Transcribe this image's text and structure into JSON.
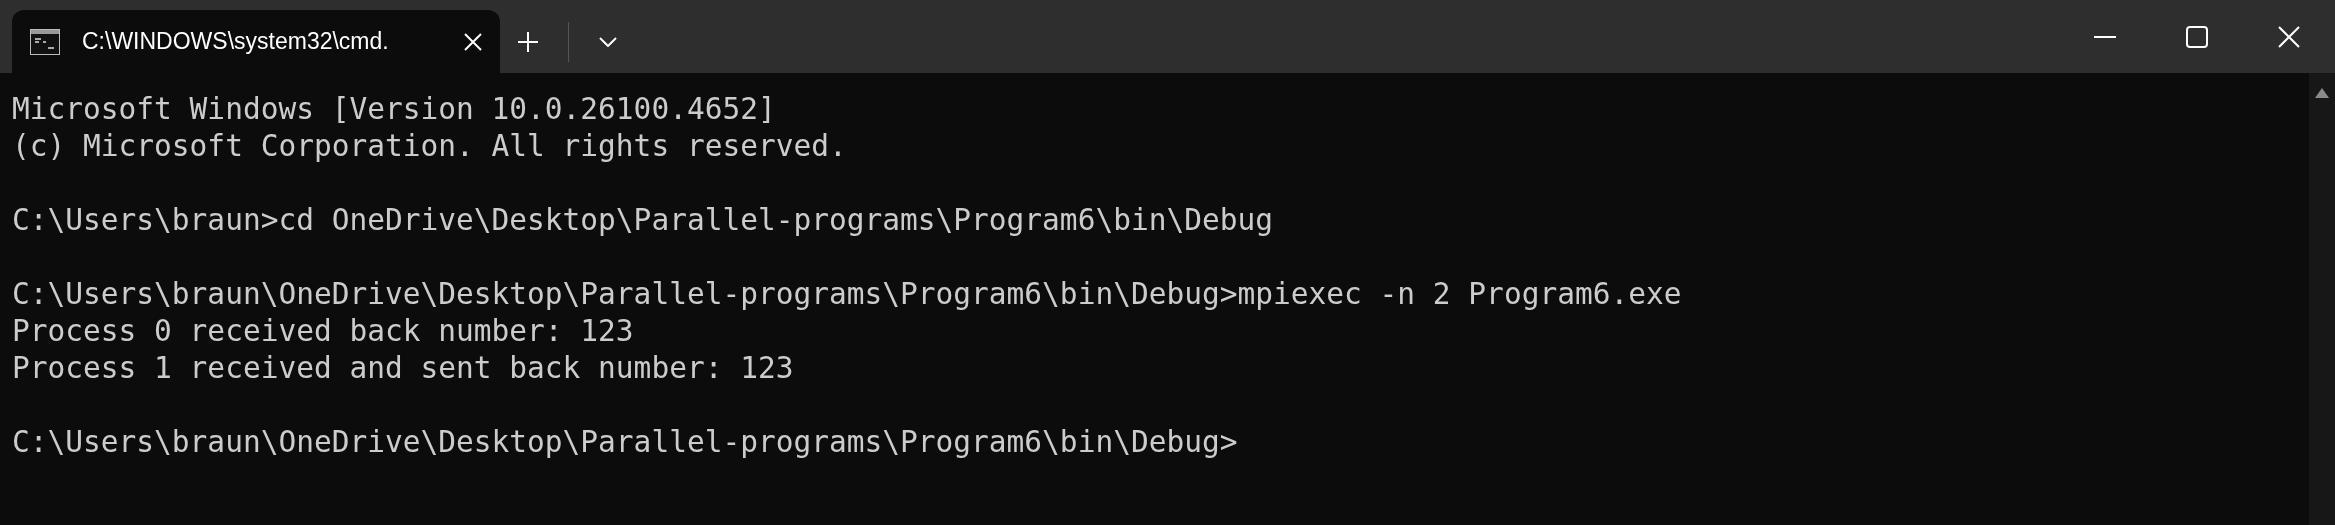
{
  "tabs": [
    {
      "title": "C:\\WINDOWS\\system32\\cmd.",
      "selected": true
    }
  ],
  "terminal": {
    "blocks": [
      [
        "Microsoft Windows [Version 10.0.26100.4652]",
        "(c) Microsoft Corporation. All rights reserved."
      ],
      [
        "C:\\Users\\braun>cd OneDrive\\Desktop\\Parallel-programs\\Program6\\bin\\Debug"
      ],
      [
        "C:\\Users\\braun\\OneDrive\\Desktop\\Parallel-programs\\Program6\\bin\\Debug>mpiexec -n 2 Program6.exe",
        "Process 0 received back number: 123",
        "Process 1 received and sent back number: 123"
      ],
      [
        "C:\\Users\\braun\\OneDrive\\Desktop\\Parallel-programs\\Program6\\bin\\Debug>"
      ]
    ]
  }
}
